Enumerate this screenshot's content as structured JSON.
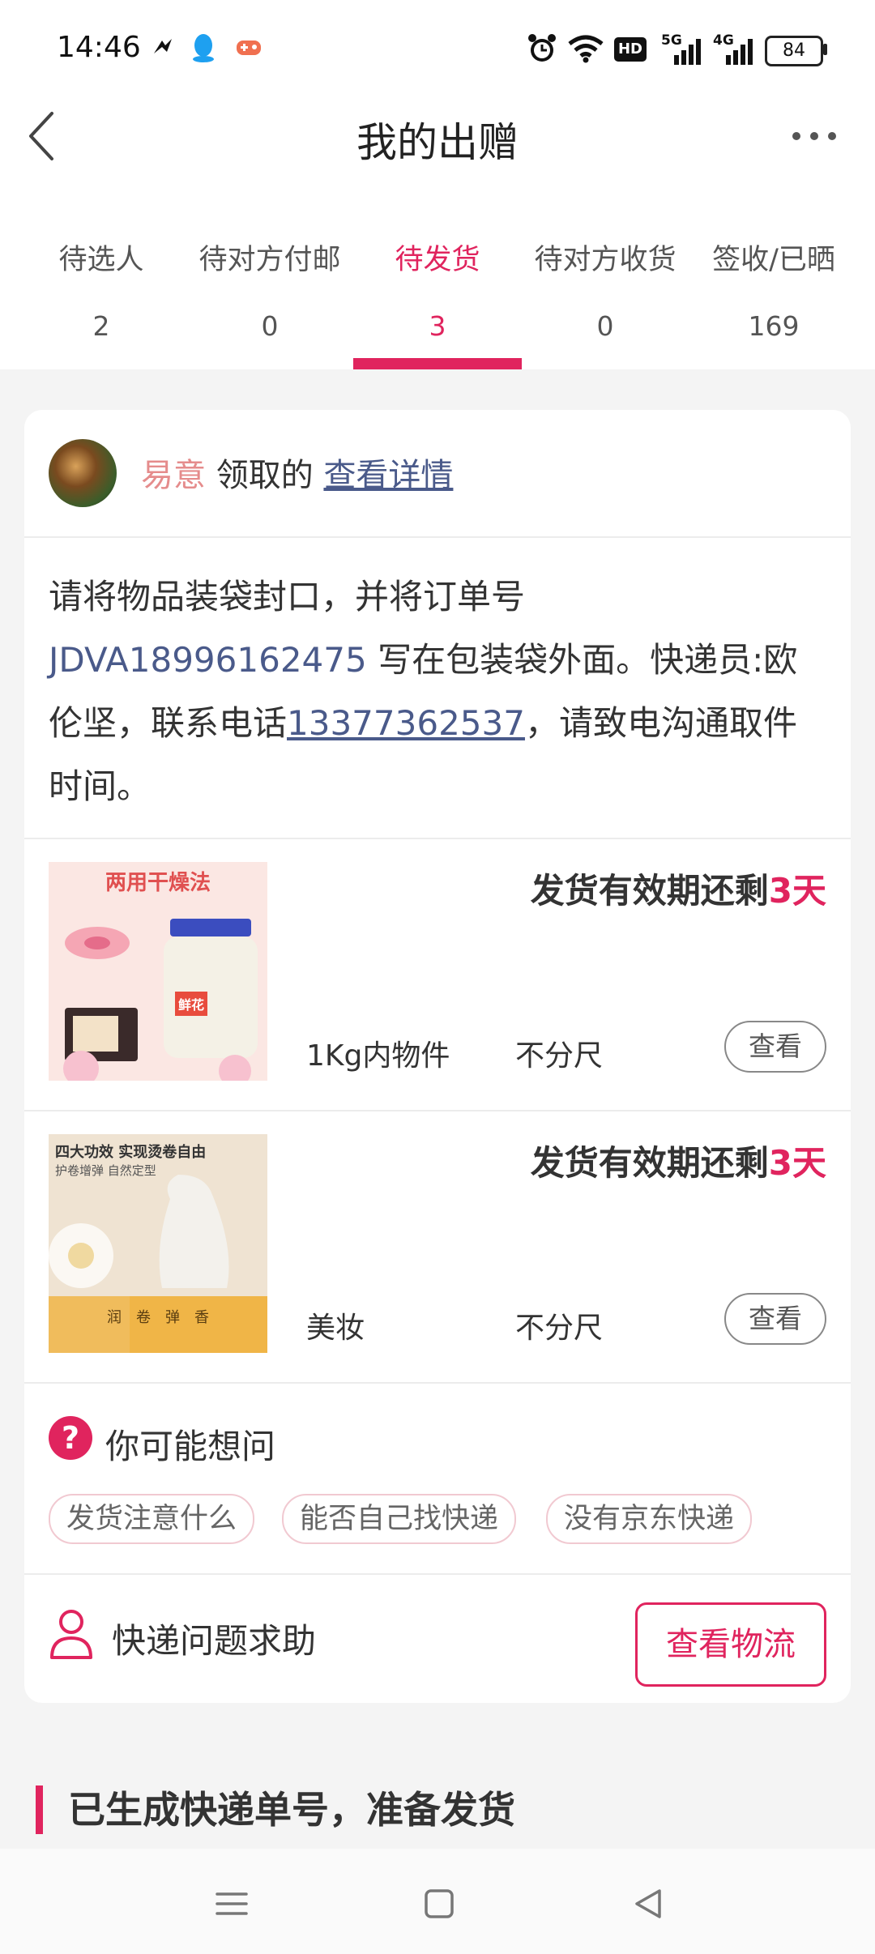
{
  "status_bar": {
    "time": "14:46",
    "battery": "84",
    "signal1": "5G",
    "signal2": "4G",
    "hd": "HD"
  },
  "header": {
    "title": "我的出赠"
  },
  "tabs": [
    {
      "label": "待选人",
      "count": "2"
    },
    {
      "label": "待对方付邮",
      "count": "0"
    },
    {
      "label": "待发货",
      "count": "3"
    },
    {
      "label": "待对方收货",
      "count": "0"
    },
    {
      "label": "签收/已晒",
      "count": "169"
    }
  ],
  "active_tab": "待发货",
  "card": {
    "claimer_name": "易意",
    "claim_text": " 领取的 ",
    "detail_link": "查看详情",
    "instructions": {
      "part1": "请将物品装袋封口，并将订单号 ",
      "order_no": "JDVA18996162475",
      "part2": " 写在包装袋外面。快递员:欧伦坚，联系电话",
      "phone": "13377362537",
      "part3": "，请致电沟通取件时间。"
    },
    "items": [
      {
        "deadline_prefix": "发货有效期还剩",
        "deadline_days": "3天",
        "category": "1Kg内物件",
        "size": "不分尺",
        "view_label": "查看",
        "thumb_text": "两用干燥法",
        "thumb_brand": "鲜花"
      },
      {
        "deadline_prefix": "发货有效期还剩",
        "deadline_days": "3天",
        "category": "美妆",
        "size": "不分尺",
        "view_label": "查看",
        "thumb_text": "四大功效 实现烫卷自由",
        "thumb_sub": "护卷增弹 自然定型",
        "thumb_tags": "润　卷　弹　香"
      }
    ],
    "faq": {
      "icon": "?",
      "title": "你可能想问",
      "chips": [
        "发货注意什么",
        "能否自己找快递",
        "没有京东快递"
      ]
    },
    "help": {
      "label": "快递问题求助",
      "logistics_button": "查看物流"
    }
  },
  "section_title": "已生成快递单号，准备发货",
  "colors": {
    "accent": "#e0245e",
    "link": "#4a5a8a",
    "claimer": "#e58c8c"
  }
}
